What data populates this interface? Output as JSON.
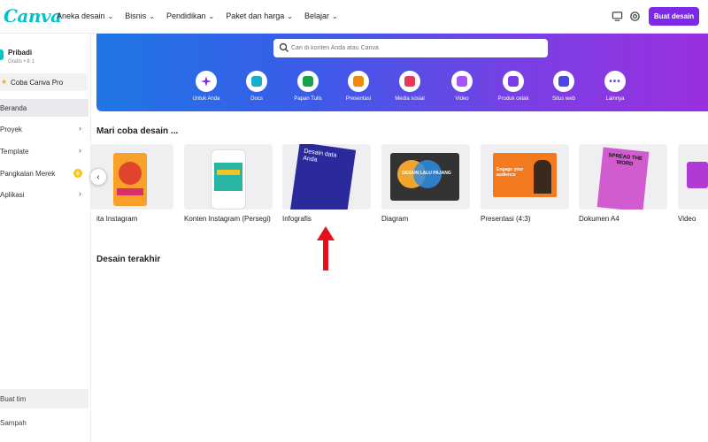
{
  "app": {
    "logo": "Canva"
  },
  "nav": [
    {
      "label": "Aneka desain"
    },
    {
      "label": "Bisnis"
    },
    {
      "label": "Pendidikan"
    },
    {
      "label": "Paket dan harga"
    },
    {
      "label": "Belajar"
    }
  ],
  "header": {
    "create_label": "Buat desain"
  },
  "sidebar": {
    "account_name": "Pribadi",
    "account_sub": "Gratis • 8 1",
    "pro_label": "Coba Canva Pro",
    "items": [
      {
        "label": "Beranda"
      },
      {
        "label": "Proyek"
      },
      {
        "label": "Template"
      },
      {
        "label": "Pangkalan Merek"
      },
      {
        "label": "Aplikasi"
      }
    ],
    "team_label": "Buat tim",
    "trash_label": "Sampah"
  },
  "search": {
    "placeholder": "Cari di konten Anda atau Canva"
  },
  "categories": [
    {
      "label": "Untuk Anda",
      "color": "#7d2ae8"
    },
    {
      "label": "Docs",
      "color": "#13b1c9"
    },
    {
      "label": "Papan Tulis",
      "color": "#17a34a"
    },
    {
      "label": "Presentasi",
      "color": "#f08a0c"
    },
    {
      "label": "Media sosial",
      "color": "#e8385a"
    },
    {
      "label": "Video",
      "color": "#a855f7"
    },
    {
      "label": "Produk cetak",
      "color": "#7c3aed"
    },
    {
      "label": "Situs web",
      "color": "#4f46e5"
    },
    {
      "label": "Lainnya",
      "color": "#6b4fd8"
    }
  ],
  "section": {
    "title": "Mari coba desain ..."
  },
  "cards": [
    {
      "label": "ita Instagram"
    },
    {
      "label": "Konten Instagram (Persegi)"
    },
    {
      "label": "Infografis",
      "art_title": "Desain data Anda"
    },
    {
      "label": "Diagram",
      "art_text": "DESAIN LALU PAJANG"
    },
    {
      "label": "Presentasi (4:3)",
      "art_text": "Engage your audience"
    },
    {
      "label": "Dokumen A4",
      "art_text": "SPREAD THE WORD"
    },
    {
      "label": "Video"
    }
  ],
  "recent": {
    "title": "Desain terakhir"
  }
}
